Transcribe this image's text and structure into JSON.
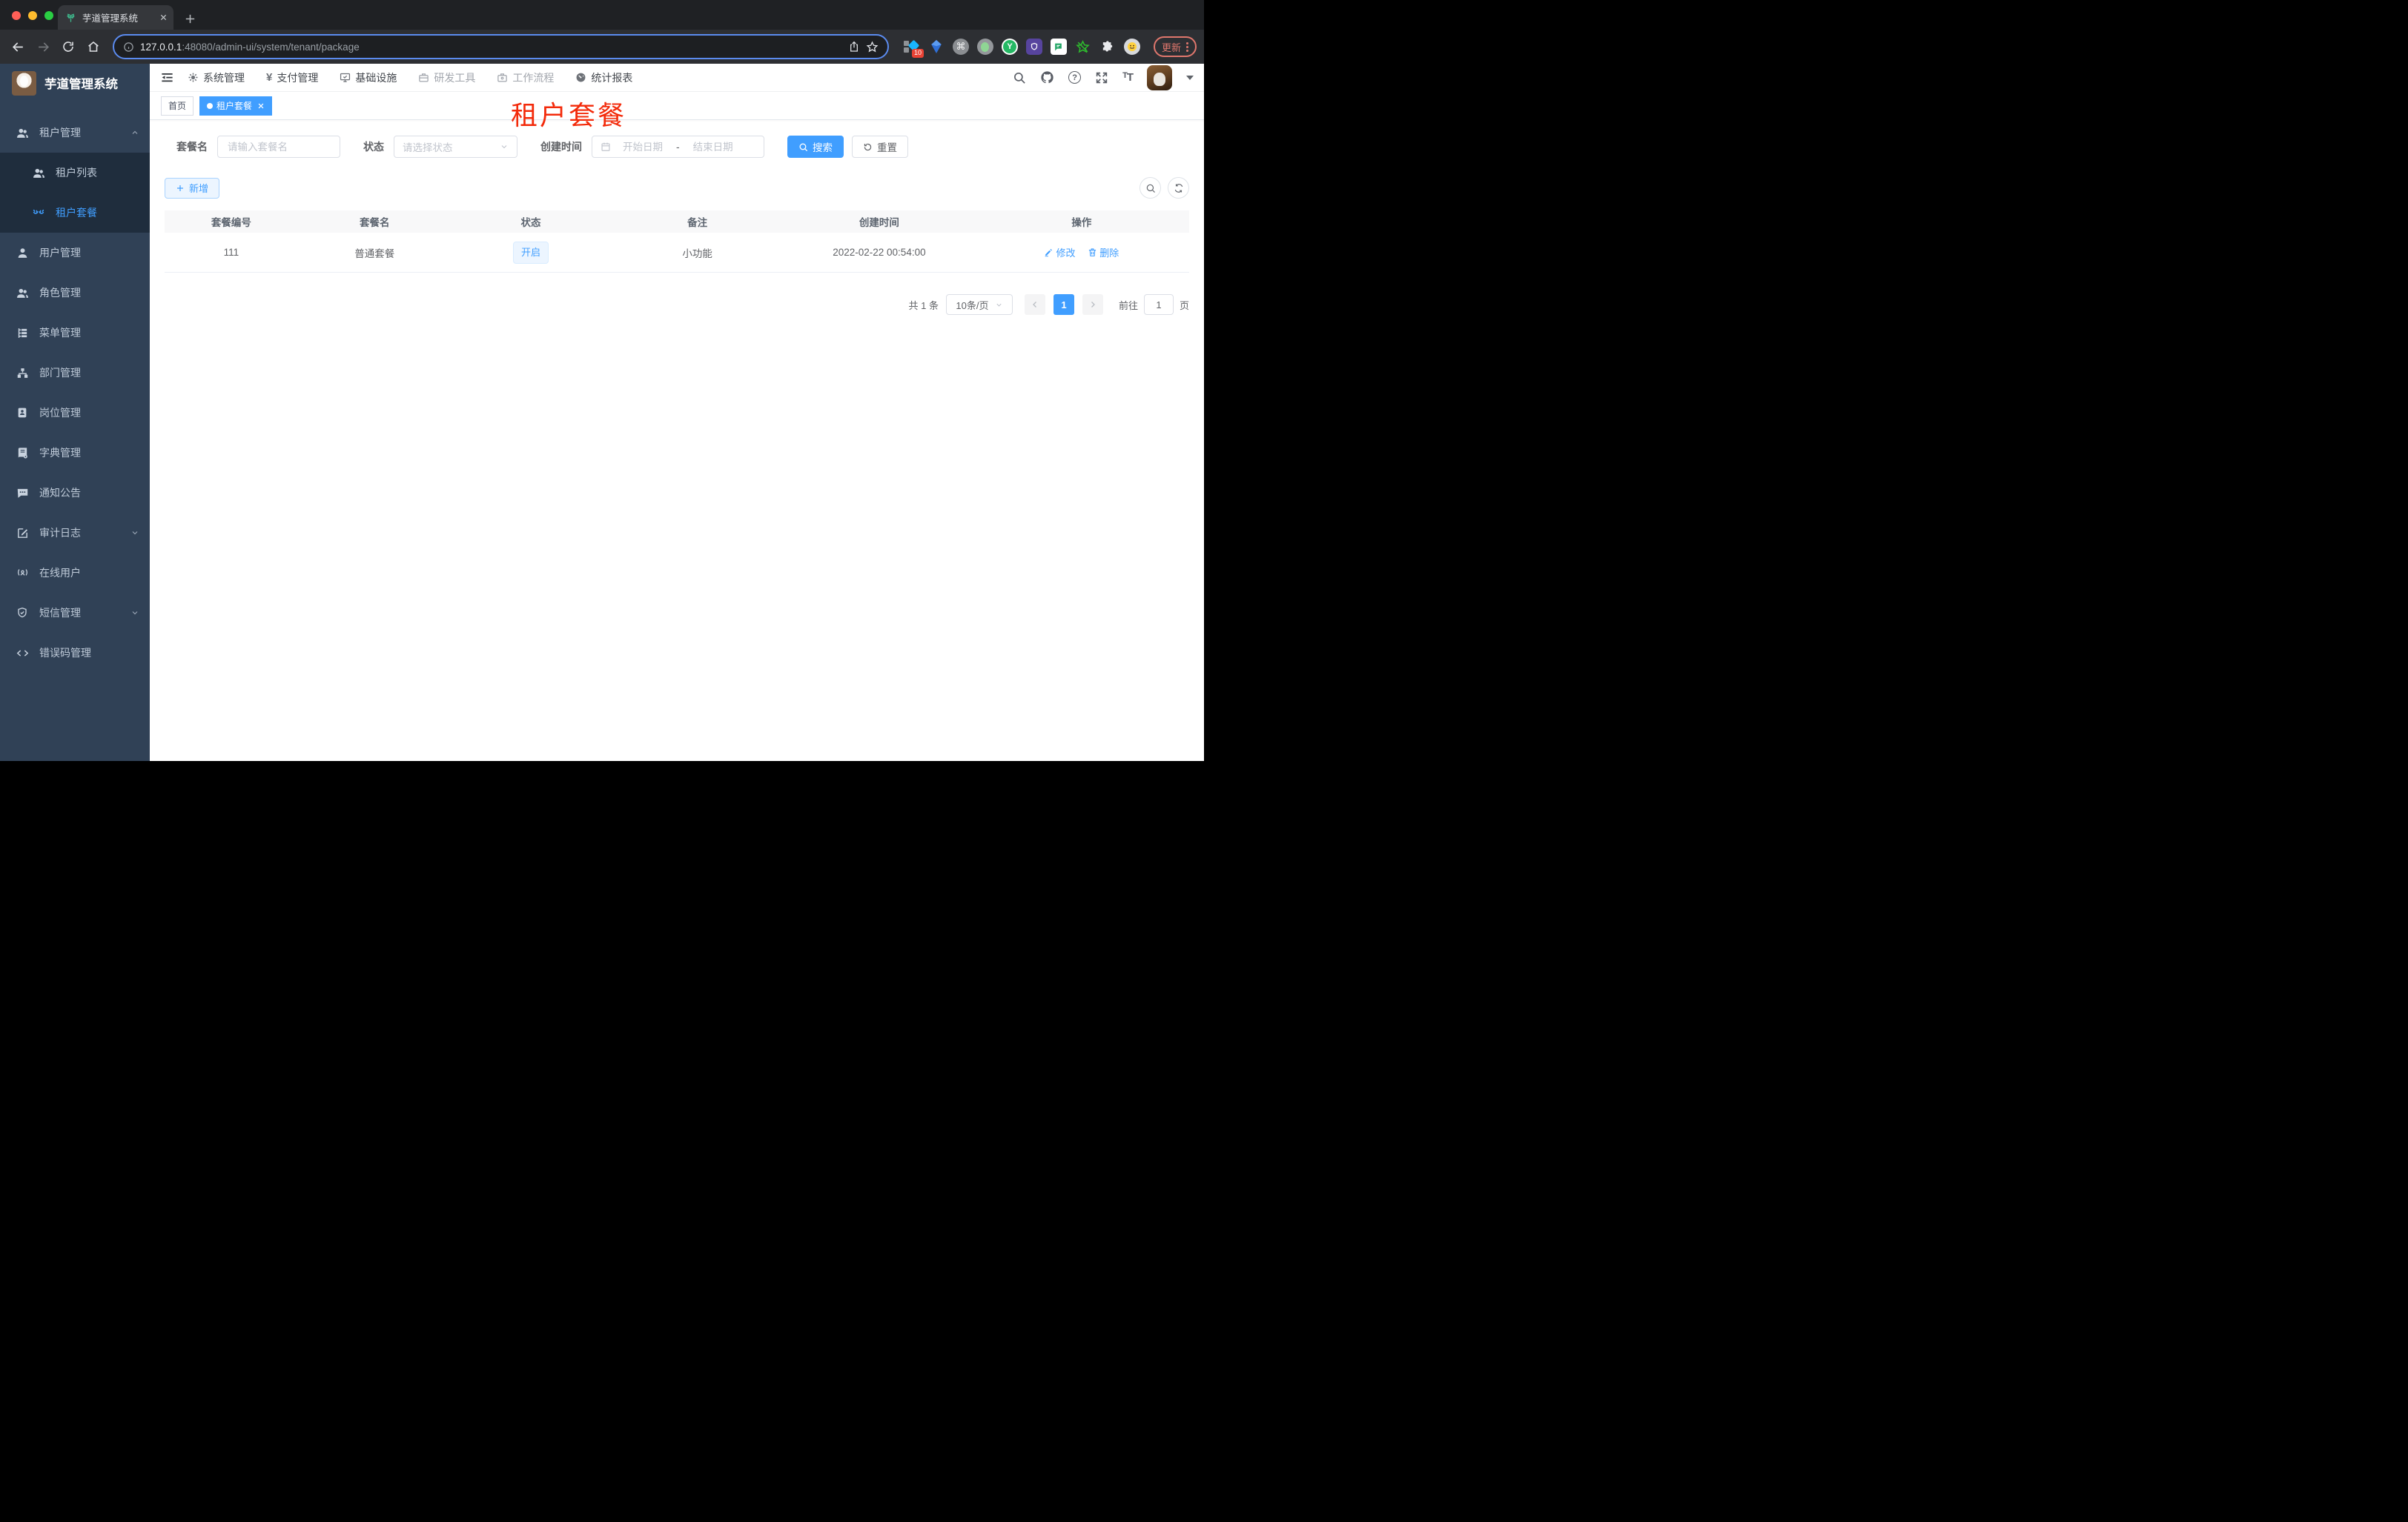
{
  "browser": {
    "tab_title": "芋道管理系统",
    "url_host": "127.0.0.1",
    "url_path": ":48080/admin-ui/system/tenant/package",
    "update_label": "更新",
    "extension_badge": "10",
    "extensions": [
      "tampermonkey",
      "gem",
      "command",
      "recorder",
      "yuque",
      "privacy-shield",
      "chat",
      "evernote-star",
      "puzzle",
      "emoji"
    ]
  },
  "sidebar": {
    "logo_title": "芋道管理系统",
    "items": [
      {
        "label": "租户管理",
        "icon": "users-icon",
        "state": "expanded"
      },
      {
        "label": "租户列表",
        "icon": "users-icon",
        "submenu": true
      },
      {
        "label": "租户套餐",
        "icon": "peacock-icon",
        "submenu": true,
        "active": true
      },
      {
        "label": "用户管理",
        "icon": "user-icon"
      },
      {
        "label": "角色管理",
        "icon": "users-icon"
      },
      {
        "label": "菜单管理",
        "icon": "tree-icon"
      },
      {
        "label": "部门管理",
        "icon": "org-icon"
      },
      {
        "label": "岗位管理",
        "icon": "badge-icon"
      },
      {
        "label": "字典管理",
        "icon": "dict-icon"
      },
      {
        "label": "通知公告",
        "icon": "message-icon"
      },
      {
        "label": "审计日志",
        "icon": "log-icon",
        "state": "collapsed"
      },
      {
        "label": "在线用户",
        "icon": "online-icon"
      },
      {
        "label": "短信管理",
        "icon": "shield-icon",
        "state": "collapsed"
      },
      {
        "label": "错误码管理",
        "icon": "code-icon"
      }
    ]
  },
  "topnav": {
    "items": [
      {
        "label": "系统管理",
        "icon": "gear-icon"
      },
      {
        "label": "支付管理",
        "icon": "yen-icon"
      },
      {
        "label": "基础设施",
        "icon": "monitor-icon"
      },
      {
        "label": "研发工具",
        "icon": "toolbox-icon",
        "muted": true
      },
      {
        "label": "工作流程",
        "icon": "briefcase-icon",
        "muted": true
      },
      {
        "label": "统计报表",
        "icon": "dashboard-icon"
      }
    ],
    "right_icons": [
      "search",
      "github",
      "help",
      "fullscreen",
      "font-size",
      "avatar",
      "caret-down"
    ]
  },
  "tags": {
    "home": "首页",
    "active": "租户套餐"
  },
  "annotation": {
    "text": "租户套餐",
    "color": "#f32a0a"
  },
  "filters": {
    "name_label": "套餐名",
    "name_placeholder": "请输入套餐名",
    "status_label": "状态",
    "status_placeholder": "请选择状态",
    "date_label": "创建时间",
    "date_start_placeholder": "开始日期",
    "date_separator": "-",
    "date_end_placeholder": "结束日期",
    "search_label": "搜索",
    "reset_label": "重置"
  },
  "toolbar": {
    "add_label": "新增"
  },
  "table": {
    "columns": [
      "套餐编号",
      "套餐名",
      "状态",
      "备注",
      "创建时间",
      "操作"
    ],
    "row": {
      "id": "111",
      "name": "普通套餐",
      "status": "开启",
      "remark": "小功能",
      "created": "2022-02-22 00:54:00",
      "edit_label": "修改",
      "delete_label": "删除"
    }
  },
  "pagination": {
    "total": "共 1 条",
    "page_size": "10条/页",
    "page": "1",
    "goto_label": "前往",
    "goto_value": "1",
    "unit_label": "页"
  },
  "colors": {
    "accent": "#409eff",
    "sidebar_bg": "#304156",
    "submenu_bg": "#1f2d3d",
    "tag_bg": "#ecf5ff",
    "annotation_red": "#f32a0a"
  }
}
